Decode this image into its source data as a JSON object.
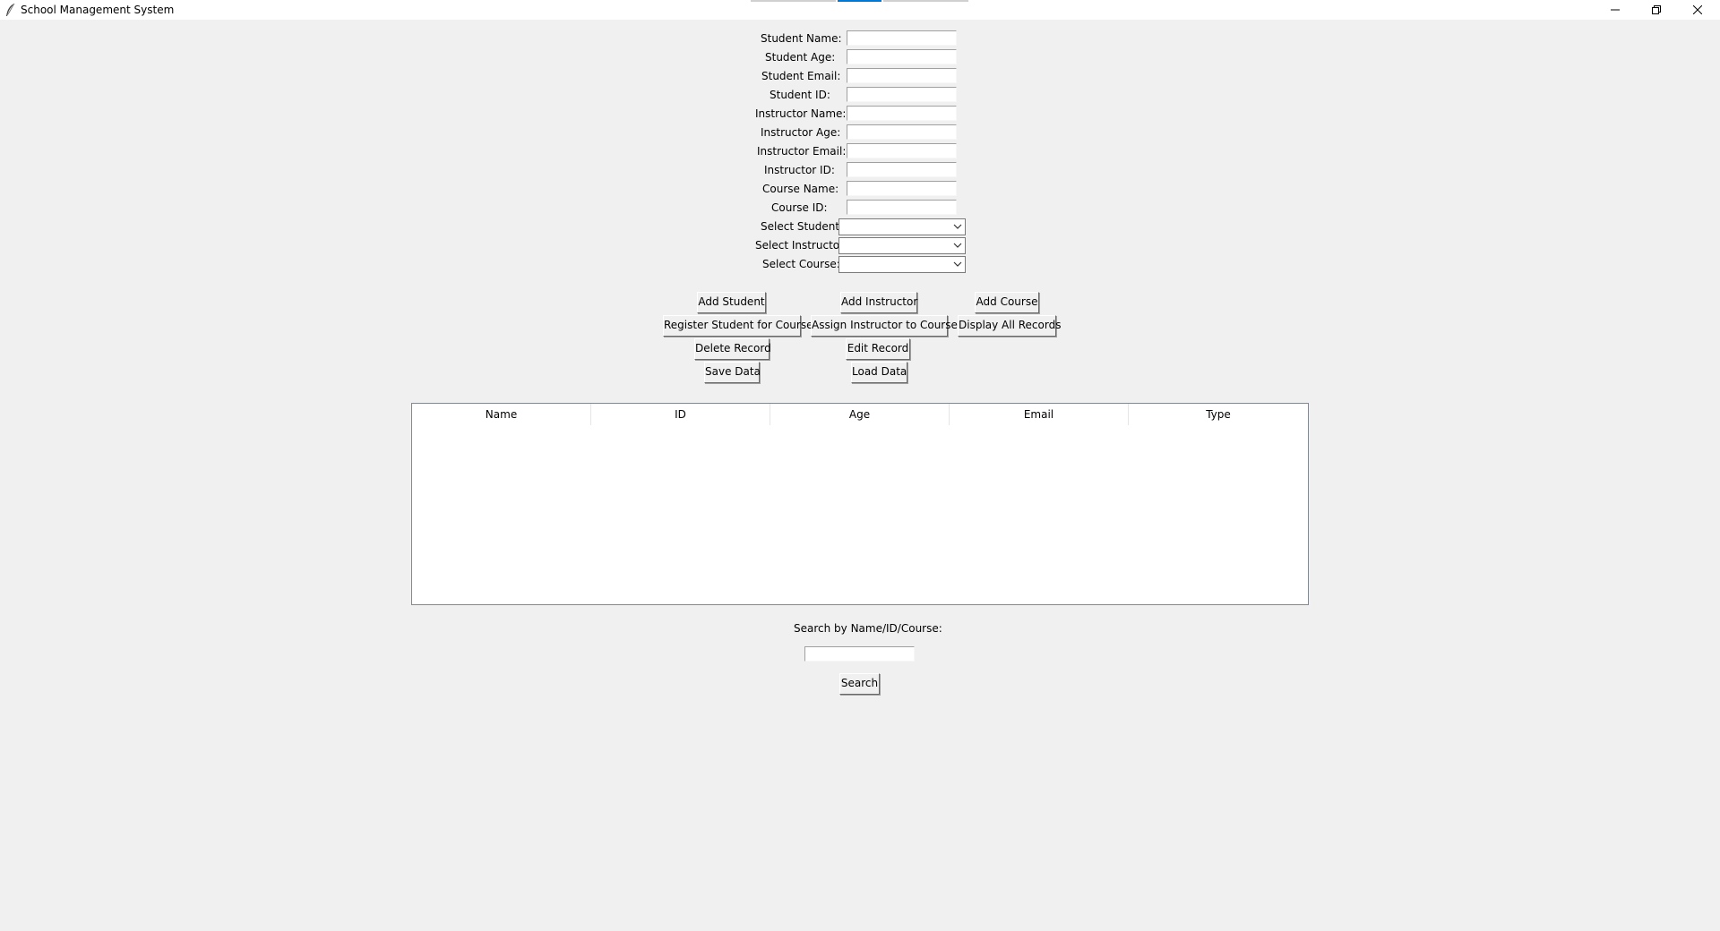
{
  "window": {
    "title": "School Management System",
    "icon": "feather-icon",
    "controls": [
      "minimize-icon",
      "restore-icon",
      "close-icon"
    ]
  },
  "form": {
    "fields": [
      {
        "label": "Student Name:",
        "value": ""
      },
      {
        "label": "Student Age:",
        "value": ""
      },
      {
        "label": "Student Email:",
        "value": ""
      },
      {
        "label": "Student ID:",
        "value": ""
      },
      {
        "label": "Instructor Name:",
        "value": ""
      },
      {
        "label": "Instructor Age:",
        "value": ""
      },
      {
        "label": "Instructor Email:",
        "value": ""
      },
      {
        "label": "Instructor ID:",
        "value": ""
      },
      {
        "label": "Course Name:",
        "value": ""
      },
      {
        "label": "Course ID:",
        "value": ""
      }
    ],
    "selects": [
      {
        "label": "Select Student:",
        "value": ""
      },
      {
        "label": "Select Instructor:",
        "value": ""
      },
      {
        "label": "Select Course:",
        "value": ""
      }
    ]
  },
  "buttons": {
    "add_student": "Add Student",
    "add_instructor": "Add Instructor",
    "add_course": "Add Course",
    "register_student": "Register Student for Course",
    "assign_instructor": "Assign Instructor to Course",
    "display_all": "Display All Records",
    "delete_record": "Delete Record",
    "edit_record": "Edit Record",
    "save_data": "Save Data",
    "load_data": "Load Data"
  },
  "table": {
    "columns": [
      "Name",
      "ID",
      "Age",
      "Email",
      "Type"
    ],
    "rows": []
  },
  "search": {
    "label": "Search by Name/ID/Course:",
    "value": "",
    "button": "Search"
  },
  "colors": {
    "background": "#f0f0f0",
    "accent": "#0078d7"
  }
}
